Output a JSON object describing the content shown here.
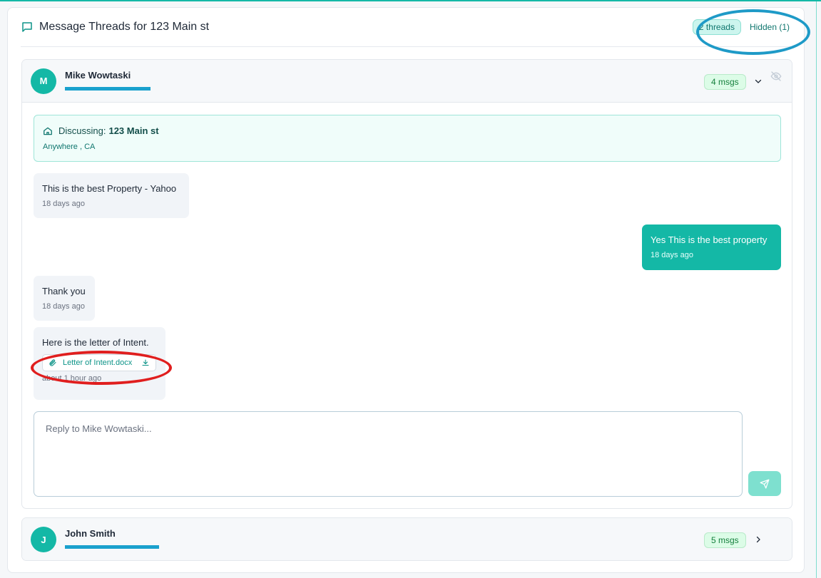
{
  "header": {
    "title": "Message Threads for 123 Main st",
    "threads_badge": "2 threads",
    "hidden_link": "Hidden (1)"
  },
  "threads": [
    {
      "initial": "M",
      "name": "Mike Wowtaski",
      "msg_count": "4 msgs",
      "expanded": true,
      "discussing": {
        "label": "Discussing:",
        "address": "123 Main st",
        "city": "Anywhere , CA"
      },
      "messages": [
        {
          "direction": "in",
          "text": "This is the best Property - Yahoo",
          "time": "18 days ago"
        },
        {
          "direction": "out",
          "text": "Yes This is the best property",
          "time": "18 days ago"
        },
        {
          "direction": "in",
          "text": "Thank you",
          "time": "18 days ago"
        },
        {
          "direction": "in",
          "text": "Here is the letter of Intent.",
          "attachment": "Letter of Intent.docx",
          "time": "about 1 hour ago"
        }
      ],
      "reply_placeholder": "Reply to Mike Wowtaski..."
    },
    {
      "initial": "J",
      "name": "John Smith",
      "msg_count": "5 msgs",
      "expanded": false
    }
  ],
  "colors": {
    "accent": "#14b8a6",
    "annotation_blue": "#1e9ac7",
    "annotation_red": "#e01e1e"
  },
  "icons": [
    "message-square-icon",
    "chevron-down-icon",
    "eye-off-icon",
    "home-icon",
    "paperclip-icon",
    "download-icon",
    "send-icon",
    "chevron-right-icon"
  ]
}
